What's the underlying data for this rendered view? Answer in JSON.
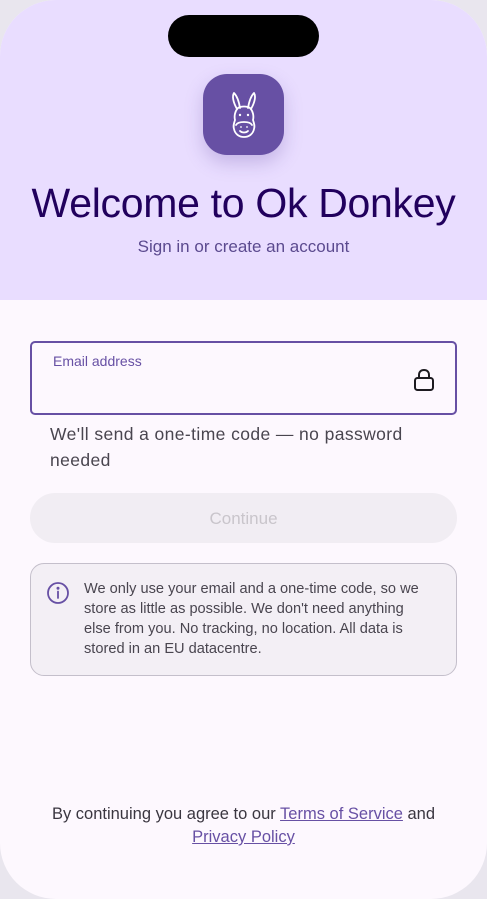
{
  "header": {
    "title": "Welcome to Ok Donkey",
    "subtitle": "Sign in or create an account",
    "logo_icon": "donkey-icon"
  },
  "email_field": {
    "label": "Email address",
    "value": "",
    "placeholder": "",
    "trailing_icon": "lock-icon"
  },
  "helper_text": "We'll send a one-time code — no password needed",
  "continue_button": {
    "label": "Continue",
    "enabled": false
  },
  "info_card": {
    "icon": "info-icon",
    "text": "We only use your email and a one-time code, so we store as little as possible. We don't need anything else from you. No tracking, no location. All data is stored in an EU datacentre."
  },
  "footer": {
    "prefix": "By continuing you agree to our ",
    "terms_link": "Terms of Service",
    "middle": " and",
    "privacy_link": "Privacy Policy"
  },
  "colors": {
    "primary": "#6750a4",
    "hero_background": "#e9ddff",
    "title": "#21005d",
    "surface": "#fdf8fe"
  }
}
